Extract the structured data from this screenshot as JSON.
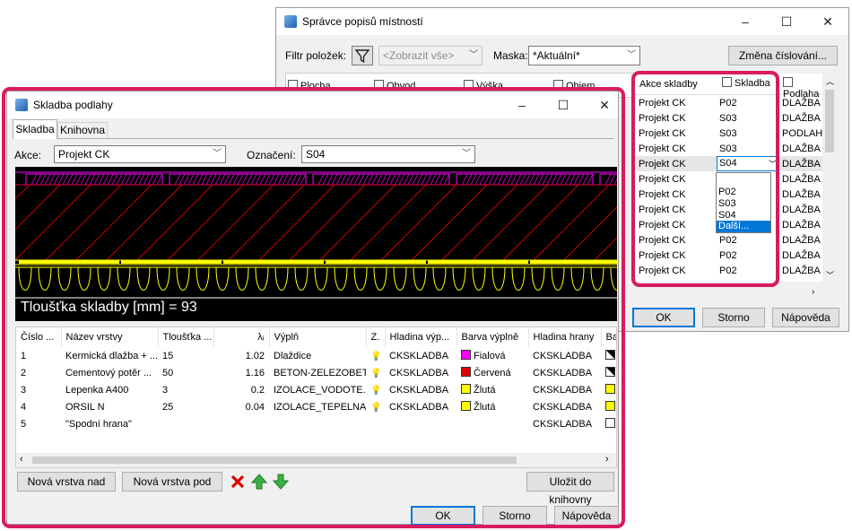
{
  "back_window": {
    "title": "Správce popisů místností",
    "filter_label": "Filtr položek:",
    "filter_value": "<Zobrazit vše>",
    "mask_label": "Maska:",
    "mask_value": "*Aktuální*",
    "renumber_button": "Změna číslování...",
    "partial_columns": [
      "Plocha",
      "Obvod",
      "Výška",
      "Objem"
    ],
    "columns": [
      "Akce skladby",
      "Skladba",
      "Podlaha"
    ],
    "rows": [
      [
        "Projekt CK",
        "P02",
        "DLAŽBA K"
      ],
      [
        "Projekt CK",
        "S03",
        "DLAŽBA K"
      ],
      [
        "Projekt CK",
        "S03",
        "PODLAHO"
      ],
      [
        "Projekt CK",
        "S03",
        "DLAŽBA K"
      ],
      [
        "Projekt CK",
        "S04",
        "DLAŽBA K"
      ],
      [
        "Projekt CK",
        "",
        "DLAŽBA K"
      ],
      [
        "Projekt CK",
        "",
        "DLAŽBA K"
      ],
      [
        "Projekt CK",
        "",
        "DLAŽBA K"
      ],
      [
        "Projekt CK",
        "",
        "DLAŽBA K"
      ],
      [
        "Projekt CK",
        "P02",
        "DLAŽBA K"
      ],
      [
        "Projekt CK",
        "P02",
        "DLAŽBA K"
      ],
      [
        "Projekt CK",
        "P02",
        "DLAŽBA K"
      ]
    ],
    "dropdown_options": [
      "P02",
      "S03",
      "S04",
      "Další..."
    ],
    "ok": "OK",
    "cancel": "Storno",
    "help": "Nápověda"
  },
  "front_window": {
    "title": "Skladba podlahy",
    "tabs": [
      "Skladba",
      "Knihovna"
    ],
    "action_label": "Akce:",
    "action_value": "Projekt CK",
    "designation_label": "Označení:",
    "designation_value": "S04",
    "preview_text": "Tloušťka skladby [mm] = 93",
    "columns": [
      "Číslo ...",
      "Název vrstvy",
      "Tloušťka ...",
      "λᵢ",
      "Výplň",
      "Z.",
      "Hladina výp...",
      "Barva výplně",
      "Hladina hrany",
      "Ba"
    ],
    "layers": [
      {
        "num": "1",
        "name": "Kermická dlažba + ...",
        "thick": "15",
        "lambda": "1.02",
        "fill": "Dlaždice",
        "layer": "CKSKLADBA",
        "color_name": "Fialová",
        "color": "#ff00ff",
        "edge": "CKSKLADBA",
        "edge_swatch": "diag"
      },
      {
        "num": "2",
        "name": "Cementový potěr ...",
        "thick": "50",
        "lambda": "1.16",
        "fill": "BETON-ZELEZOBET...",
        "layer": "CKSKLADBA",
        "color_name": "Červená",
        "color": "#e00000",
        "edge": "CKSKLADBA",
        "edge_swatch": "diag"
      },
      {
        "num": "3",
        "name": "Lepenka A400",
        "thick": "3",
        "lambda": "0.2",
        "fill": "IZOLACE_VODOTE...",
        "layer": "CKSKLADBA",
        "color_name": "Žlutá",
        "color": "#ffff00",
        "edge": "CKSKLADBA",
        "edge_swatch": "yellow"
      },
      {
        "num": "4",
        "name": "ORSIL N",
        "thick": "25",
        "lambda": "0.04",
        "fill": "IZOLACE_TEPELNA_U",
        "layer": "CKSKLADBA",
        "color_name": "Žlutá",
        "color": "#ffff00",
        "edge": "CKSKLADBA",
        "edge_swatch": "yellow"
      },
      {
        "num": "5",
        "name": "\"Spodní hrana\"",
        "thick": "",
        "lambda": "",
        "fill": "",
        "layer": "",
        "color_name": "",
        "color": "",
        "edge": "CKSKLADBA",
        "edge_swatch": "white"
      }
    ],
    "btn_new_above": "Nová vrstva nad",
    "btn_new_below": "Nová vrstva pod",
    "btn_save_library": "Uložit do knihovny",
    "ok": "OK",
    "cancel": "Storno",
    "help": "Nápověda"
  },
  "colors": {
    "highlight": "#d81b60",
    "accent": "#0078d7",
    "selection": "#0078d7"
  }
}
